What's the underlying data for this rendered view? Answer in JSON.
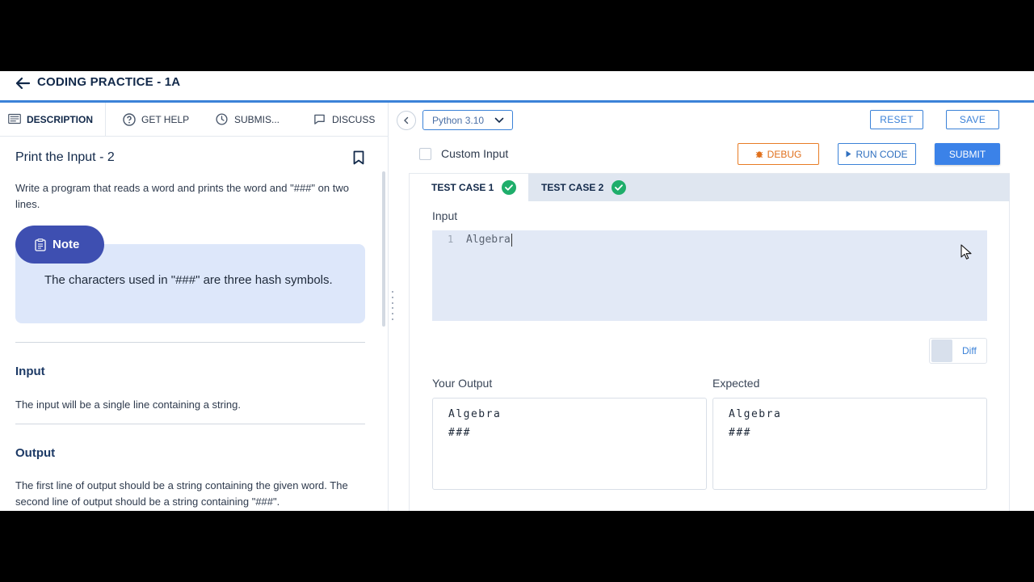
{
  "header": {
    "title": "CODING PRACTICE - 1A"
  },
  "left_tabs": [
    {
      "label": "DESCRIPTION",
      "icon": "description-icon",
      "active": true
    },
    {
      "label": "GET HELP",
      "icon": "help-icon"
    },
    {
      "label": "SUBMIS...",
      "icon": "clock-icon"
    },
    {
      "label": "DISCUSS",
      "icon": "chat-icon"
    }
  ],
  "question": {
    "title": "Print the Input - 2",
    "description": "Write a program that reads a word and prints the word and \"###\" on two lines.",
    "note_label": "Note",
    "note_text": "The characters used in \"###\" are three hash symbols.",
    "input_heading": "Input",
    "input_text": "The input will be a single line containing a string.",
    "output_heading": "Output",
    "output_text": "The first line of output should be a string containing the given word. The second line of output should be a string containing \"###\"."
  },
  "editor_bar": {
    "language": "Python 3.10",
    "reset_label": "RESET",
    "save_label": "SAVE",
    "custom_input_label": "Custom Input",
    "debug_label": "DEBUG",
    "run_label": "RUN CODE",
    "submit_label": "SUBMIT"
  },
  "test_cases": {
    "tabs": [
      {
        "label": "TEST CASE 1",
        "status": "passed",
        "active": true
      },
      {
        "label": "TEST CASE 2",
        "status": "passed",
        "active": false
      }
    ],
    "input_label": "Input",
    "input_line_number": "1",
    "input_value": "Algebra",
    "diff_label": "Diff",
    "your_output_label": "Your Output",
    "your_output": "Algebra\n###",
    "expected_label": "Expected",
    "expected_output": "Algebra\n###"
  },
  "colors": {
    "accent": "#3b82d8",
    "note_pill": "#3e4fb1",
    "note_bg": "#dde7fa",
    "success": "#1fae6b",
    "debug": "#e87c25"
  }
}
